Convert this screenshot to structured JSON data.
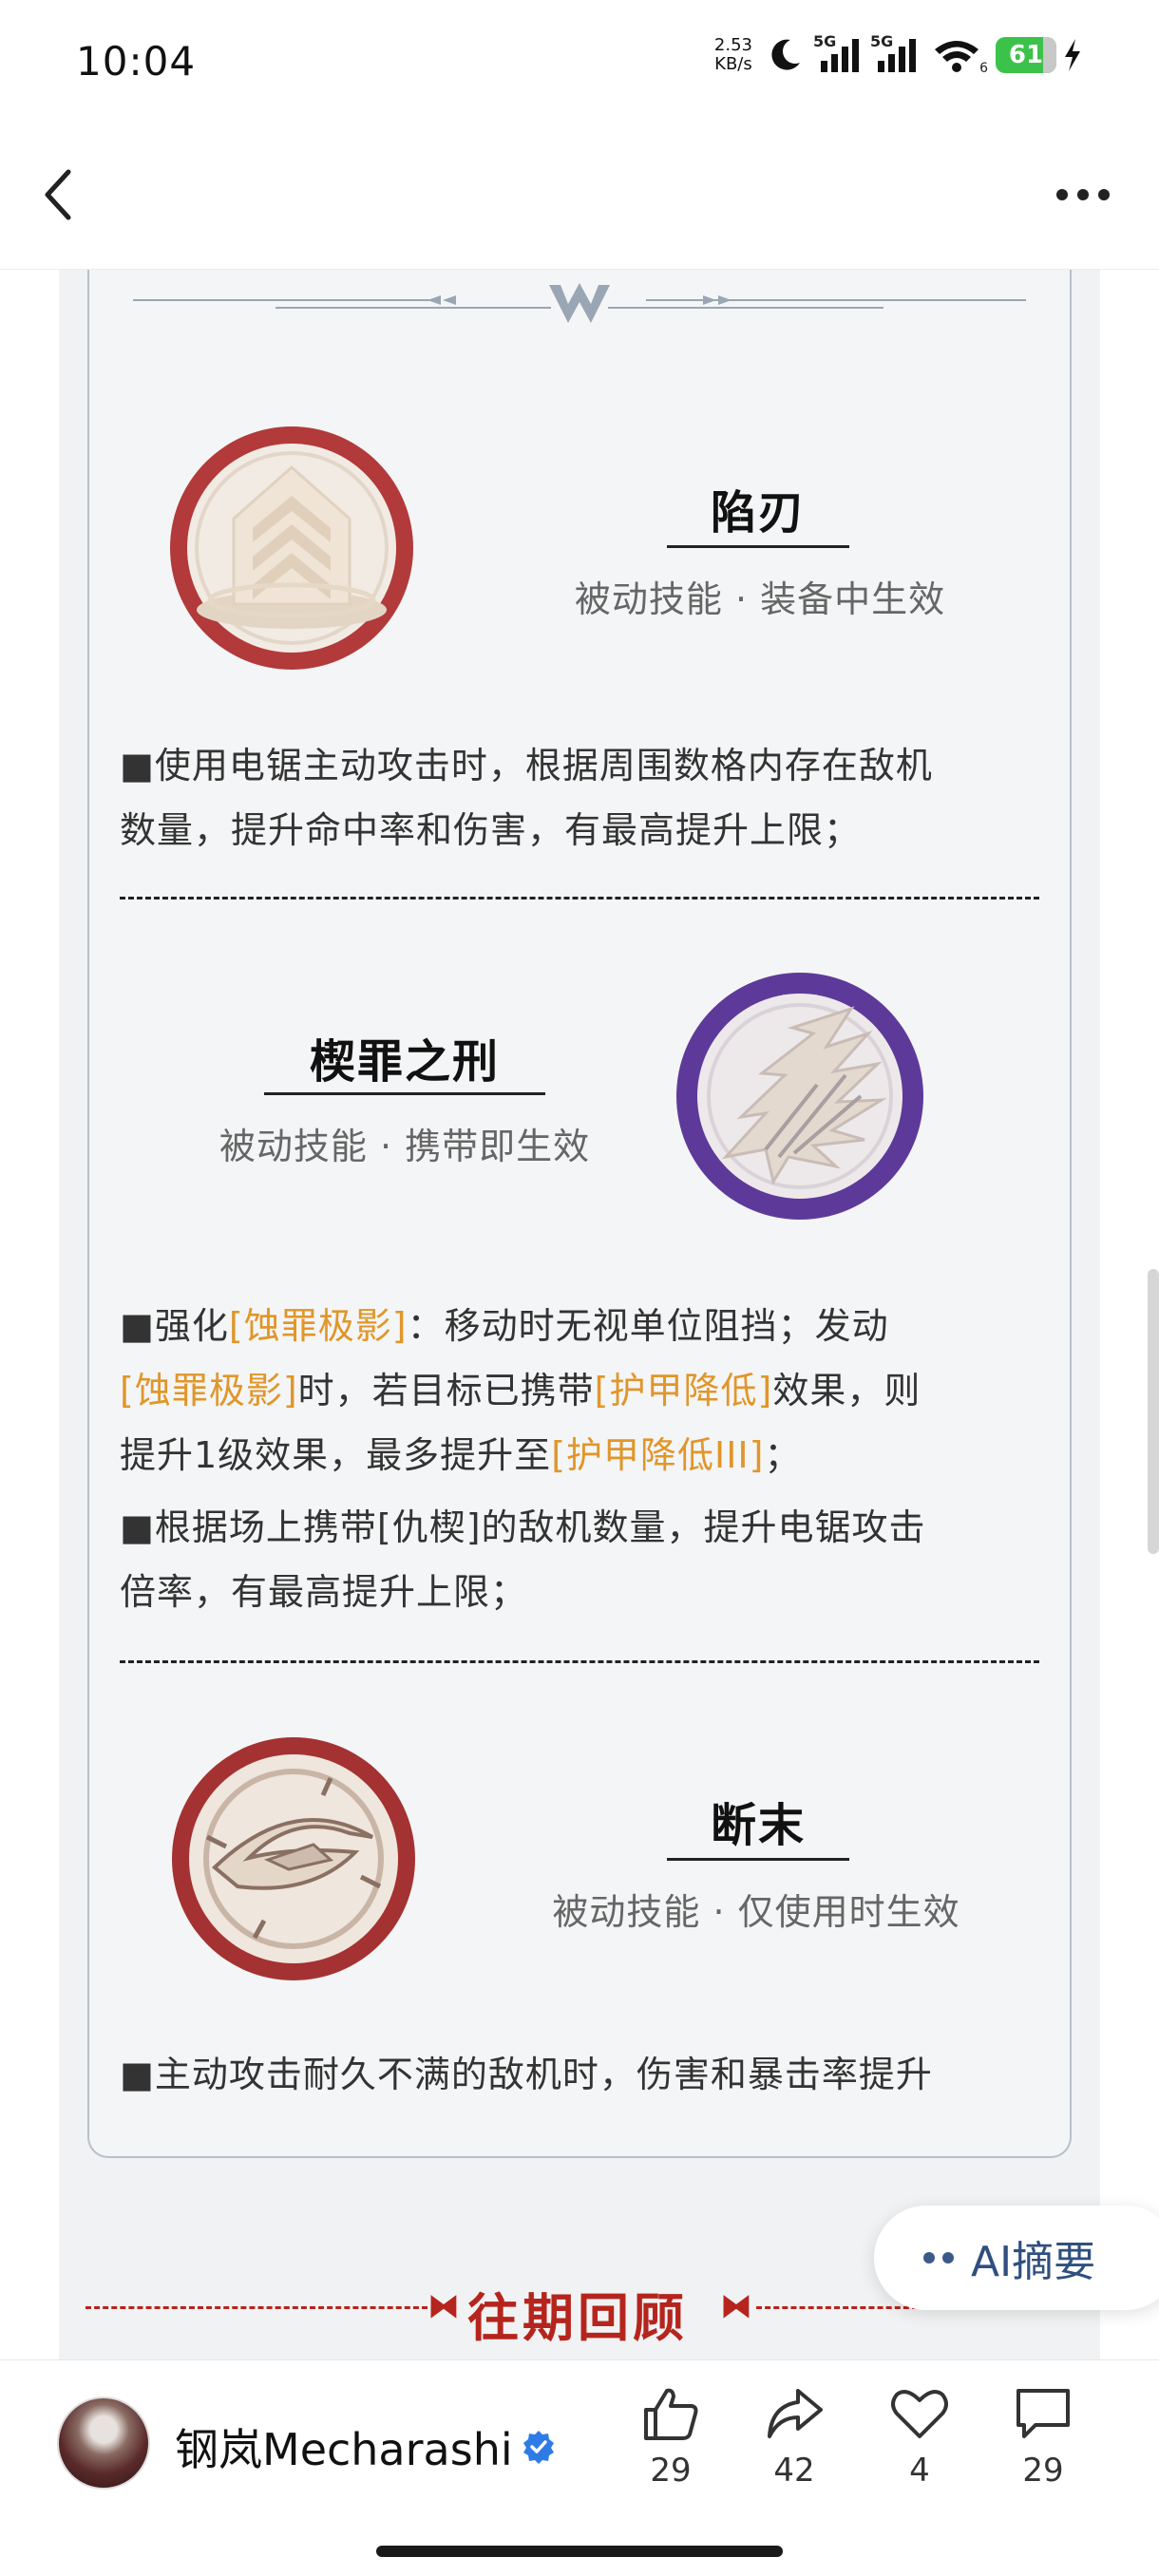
{
  "status_bar": {
    "time": "10:04",
    "net_speed_value": "2.53",
    "net_speed_unit": "KB/s",
    "signal1_label": "5G",
    "signal2_label": "5G",
    "wifi_label": "6",
    "battery": "61",
    "icons": [
      "moon-icon",
      "signal-icon",
      "signal-icon",
      "wifi-icon",
      "battery-icon",
      "charging-icon"
    ]
  },
  "nav": {
    "icons": [
      "back-arrow-icon",
      "more-dots-icon"
    ]
  },
  "skills": [
    {
      "name": "陷刃",
      "subtitle": "被动技能 · 装备中生效",
      "icon": "tower-emblem-icon",
      "description_lines": [
        "■使用电锯主动攻击时，根据周围数格内存在敌机",
        "数量，提升命中率和伤害，有最高提升上限；"
      ]
    },
    {
      "name": "楔罪之刑",
      "subtitle": "被动技能 · 携带即生效",
      "icon": "wing-emblem-icon",
      "description": {
        "p1_a": "■强化",
        "p1_hl1": "[蚀罪极影]",
        "p1_b": "：移动时无视单位阻挡；发动",
        "p1_hl2": "[蚀罪极影]",
        "p1_c": "时，若目标已携带",
        "p1_hl3": "[护甲降低]",
        "p1_d": "效果，则",
        "p1_e": "提升1级效果，最多提升至",
        "p1_hl4": "[护甲降低III]",
        "p1_f": "；",
        "p2_line1": "■根据场上携带[仇楔]的敌机数量，提升电锯攻击",
        "p2_line2": "倍率，有最高提升上限；"
      }
    },
    {
      "name": "断末",
      "subtitle": "被动技能 · 仅使用时生效",
      "icon": "eye-emblem-icon",
      "description_lines": [
        "■主动攻击耐久不满的敌机时，伤害和暴击率提升"
      ]
    }
  ],
  "review": {
    "title": "往期回顾"
  },
  "ai_summary": {
    "label": "AI摘要"
  },
  "bottom_bar": {
    "author": "钢岚Mecharashi",
    "likes": "29",
    "shares": "42",
    "favorites": "4",
    "comments": "29"
  },
  "colors": {
    "highlight": "#e0962a",
    "review_red": "#b5251d",
    "emblem_red": "#b23a3a",
    "emblem_purple": "#5d3a9a"
  }
}
